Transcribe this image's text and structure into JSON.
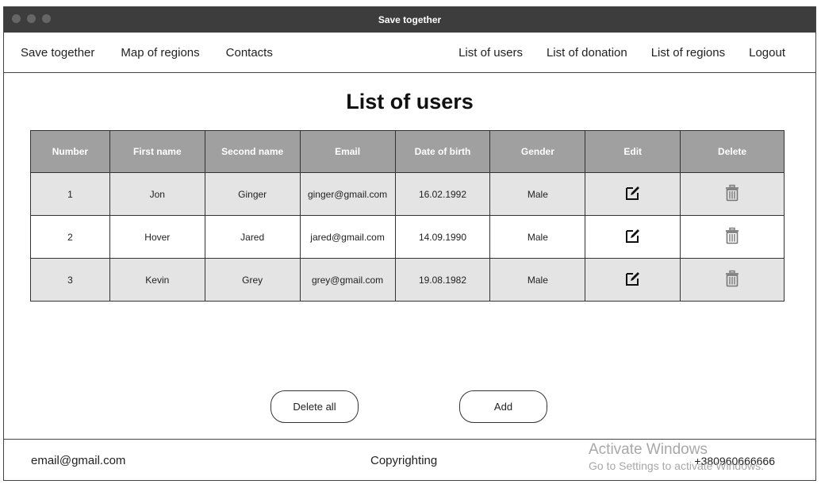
{
  "window": {
    "title": "Save together"
  },
  "nav": {
    "left": [
      "Save together",
      "Map of regions",
      "Contacts"
    ],
    "right": [
      "List of users",
      "List of donation",
      "List of regions",
      "Logout"
    ]
  },
  "page_title": "List of users",
  "table": {
    "headers": [
      "Number",
      "First name",
      "Second name",
      "Email",
      "Date of birth",
      "Gender",
      "Edit",
      "Delete"
    ],
    "rows": [
      {
        "number": "1",
        "first_name": "Jon",
        "second_name": "Ginger",
        "email": "ginger@gmail.com",
        "dob": "16.02.1992",
        "gender": "Male"
      },
      {
        "number": "2",
        "first_name": "Hover",
        "second_name": "Jared",
        "email": "jared@gmail.com",
        "dob": "14.09.1990",
        "gender": "Male"
      },
      {
        "number": "3",
        "first_name": "Kevin",
        "second_name": "Grey",
        "email": "grey@gmail.com",
        "dob": "19.08.1982",
        "gender": "Male"
      }
    ],
    "edit_icon": "edit-icon",
    "delete_icon": "trash-icon"
  },
  "buttons": {
    "delete_all": "Delete all",
    "add": "Add"
  },
  "footer": {
    "email": "email@gmail.com",
    "copyright": "Copyrighting",
    "phone": "+380960666666"
  },
  "watermark": {
    "line1": "Activate Windows",
    "line2": "Go to Settings to activate Windows."
  }
}
